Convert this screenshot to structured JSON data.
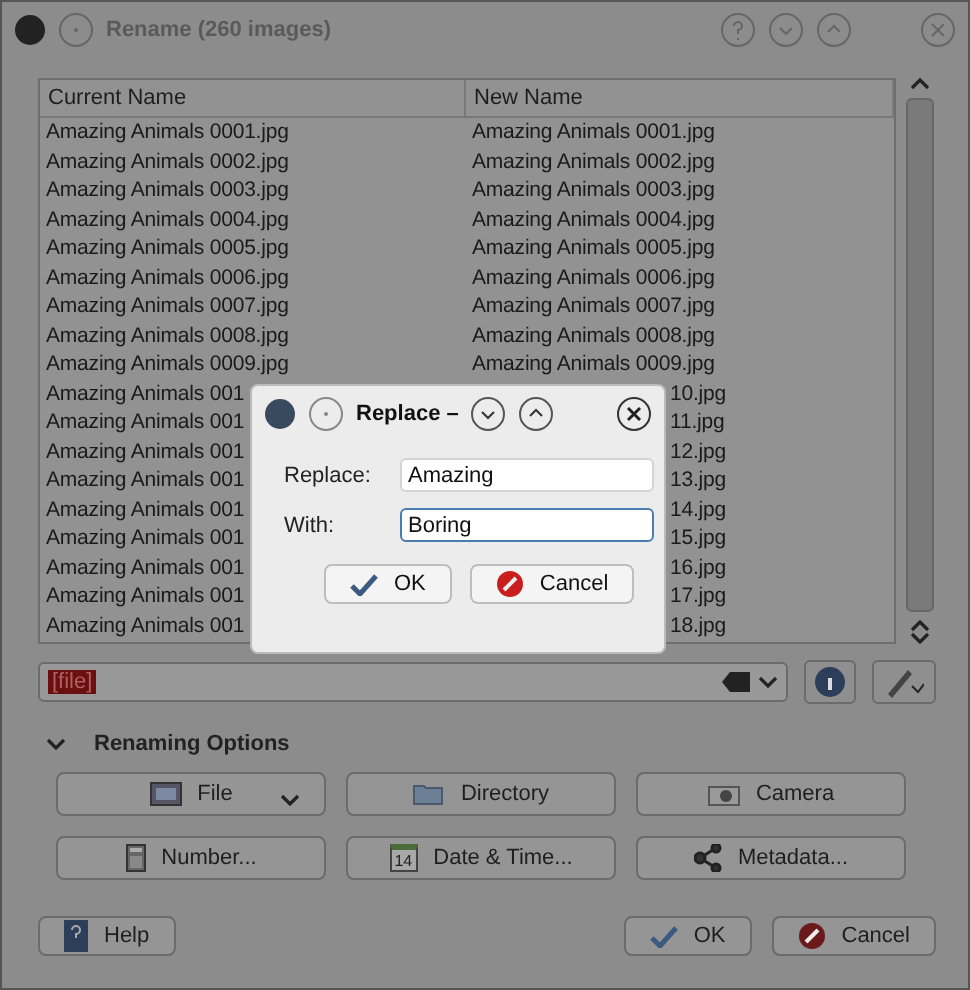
{
  "window": {
    "title": "Rename (260 images)"
  },
  "table": {
    "columns": [
      "Current Name",
      "New Name"
    ],
    "rows": [
      {
        "current": "Amazing Animals 0001.jpg",
        "new": "Amazing Animals 0001.jpg",
        "covered": false
      },
      {
        "current": "Amazing Animals 0002.jpg",
        "new": "Amazing Animals 0002.jpg",
        "covered": false
      },
      {
        "current": "Amazing Animals 0003.jpg",
        "new": "Amazing Animals 0003.jpg",
        "covered": false
      },
      {
        "current": "Amazing Animals 0004.jpg",
        "new": "Amazing Animals 0004.jpg",
        "covered": false
      },
      {
        "current": "Amazing Animals 0005.jpg",
        "new": "Amazing Animals 0005.jpg",
        "covered": false
      },
      {
        "current": "Amazing Animals 0006.jpg",
        "new": "Amazing Animals 0006.jpg",
        "covered": false
      },
      {
        "current": "Amazing Animals 0007.jpg",
        "new": "Amazing Animals 0007.jpg",
        "covered": false
      },
      {
        "current": "Amazing Animals 0008.jpg",
        "new": "Amazing Animals 0008.jpg",
        "covered": false
      },
      {
        "current": "Amazing Animals 0009.jpg",
        "new": "Amazing Animals 0009.jpg",
        "covered": false
      },
      {
        "current": "Amazing Animals 001",
        "new": "10.jpg",
        "covered": true
      },
      {
        "current": "Amazing Animals 001",
        "new": "11.jpg",
        "covered": true
      },
      {
        "current": "Amazing Animals 001",
        "new": "12.jpg",
        "covered": true
      },
      {
        "current": "Amazing Animals 001",
        "new": "13.jpg",
        "covered": true
      },
      {
        "current": "Amazing Animals 001",
        "new": "14.jpg",
        "covered": true
      },
      {
        "current": "Amazing Animals 001",
        "new": "15.jpg",
        "covered": true
      },
      {
        "current": "Amazing Animals 001",
        "new": "16.jpg",
        "covered": true
      },
      {
        "current": "Amazing Animals 001",
        "new": "17.jpg",
        "covered": true
      },
      {
        "current": "Amazing Animals 001",
        "new": "18.jpg",
        "covered": true
      }
    ]
  },
  "parser": {
    "value": "[file]"
  },
  "options": {
    "title": "Renaming Options",
    "expanded": true,
    "buttons": [
      {
        "label": "File",
        "menu": true
      },
      {
        "label": "Directory",
        "menu": false
      },
      {
        "label": "Camera",
        "menu": false
      },
      {
        "label": "Number...",
        "menu": false
      },
      {
        "label": "Date & Time...",
        "menu": false
      },
      {
        "label": "Metadata...",
        "menu": false
      }
    ]
  },
  "calendar_day": "14",
  "footer": {
    "help": "Help",
    "ok": "OK",
    "cancel": "Cancel"
  },
  "dialog": {
    "title": "Replace –",
    "replace_label": "Replace:",
    "replace_value": "Amazing",
    "with_label": "With:",
    "with_value": "Boring",
    "ok": "OK",
    "cancel": "Cancel"
  }
}
